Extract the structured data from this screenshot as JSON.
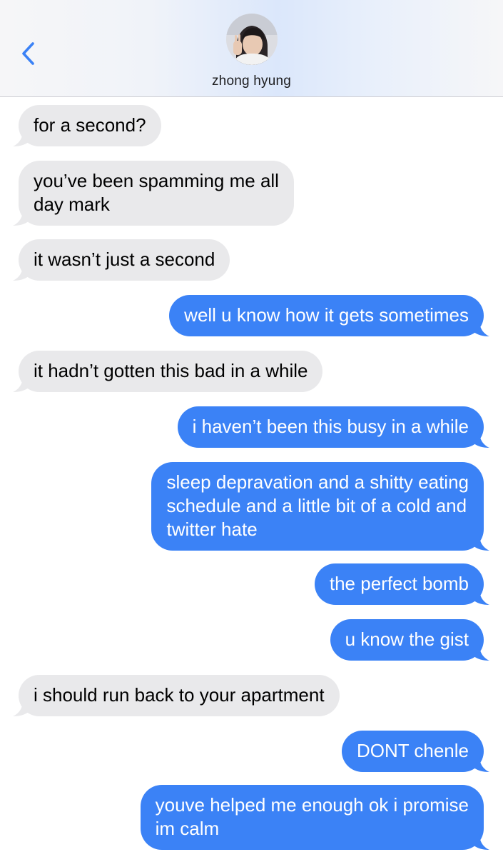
{
  "header": {
    "contact_name": "zhong hyung",
    "back_icon": "chevron-left-icon",
    "accent": "#3b82f6"
  },
  "colors": {
    "sent_bubble": "#3b82f6",
    "received_bubble": "#e9e9eb"
  },
  "messages": [
    {
      "from": "them",
      "text": "for a second?"
    },
    {
      "from": "them",
      "text": "you’ve been spamming me all\nday mark"
    },
    {
      "from": "them",
      "text": "it wasn’t just a second"
    },
    {
      "from": "me",
      "text": "well u know how it gets sometimes"
    },
    {
      "from": "them",
      "text": "it hadn’t gotten this bad in a while"
    },
    {
      "from": "me",
      "text": "i haven’t been this busy in a while"
    },
    {
      "from": "me",
      "text": "sleep depravation and a shitty eating\nschedule and a little bit of a cold and\ntwitter hate"
    },
    {
      "from": "me",
      "text": "the perfect bomb"
    },
    {
      "from": "me",
      "text": "u know the gist"
    },
    {
      "from": "them",
      "text": "i should run back to your apartment"
    },
    {
      "from": "me",
      "text": "DONT chenle"
    },
    {
      "from": "me",
      "text": "youve helped me enough ok i promise\nim calm"
    }
  ]
}
